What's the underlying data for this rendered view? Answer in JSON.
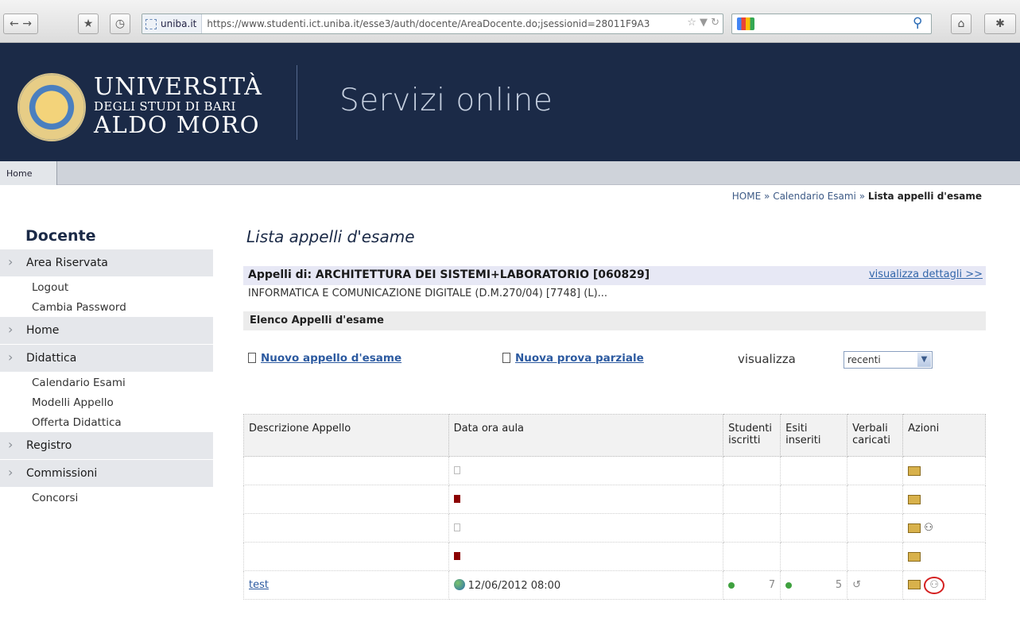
{
  "browser": {
    "url_site": "uniba.it",
    "url": "https://www.studenti.ict.uniba.it/esse3/auth/docente/AreaDocente.do;jsessionid=28011F9A3"
  },
  "header": {
    "uni_line1": "UNIVERSITÀ",
    "uni_line2": "DEGLI STUDI DI BARI",
    "uni_line3": "ALDO MORO",
    "service_title": "Servizi online"
  },
  "topnav": {
    "home": "Home"
  },
  "breadcrumb": {
    "home": "HOME",
    "calendar": "Calendario Esami",
    "current": "Lista appelli d'esame",
    "sep": "»"
  },
  "sidebar": {
    "title": "Docente",
    "items": [
      {
        "type": "section",
        "label": "Area Riservata"
      },
      {
        "type": "link",
        "label": "Logout"
      },
      {
        "type": "link",
        "label": "Cambia Password"
      },
      {
        "type": "section",
        "label": "Home"
      },
      {
        "type": "section",
        "label": "Didattica"
      },
      {
        "type": "link",
        "label": "Calendario Esami"
      },
      {
        "type": "link",
        "label": "Modelli Appello"
      },
      {
        "type": "link",
        "label": "Offerta Didattica"
      },
      {
        "type": "section",
        "label": "Registro"
      },
      {
        "type": "section",
        "label": "Commissioni"
      },
      {
        "type": "link",
        "label": "Concorsi"
      }
    ]
  },
  "main": {
    "title": "Lista appelli d'esame",
    "appelli_di": "Appelli di: ARCHITETTURA DEI SISTEMI+LABORATORIO [060829]",
    "dettagli": "visualizza dettagli >>",
    "corso": "INFORMATICA E COMUNICAZIONE DIGITALE (D.M.270/04) [7748] (L)...",
    "elenco": "Elenco Appelli d'esame",
    "nuovo_appello": "Nuovo appello d'esame",
    "nuova_prova": "Nuova prova parziale",
    "visualizza_label": "visualizza",
    "select_value": "recenti"
  },
  "table": {
    "headers": {
      "descrizione": "Descrizione Appello",
      "data": "Data ora aula",
      "studenti": "Studenti iscritti",
      "esiti": "Esiti inseriti",
      "verbali": "Verbali caricati",
      "azioni": "Azioni"
    },
    "test_row": {
      "descrizione": "test",
      "data": "12/06/2012 08:00",
      "studenti": "7",
      "esiti": "5"
    }
  }
}
